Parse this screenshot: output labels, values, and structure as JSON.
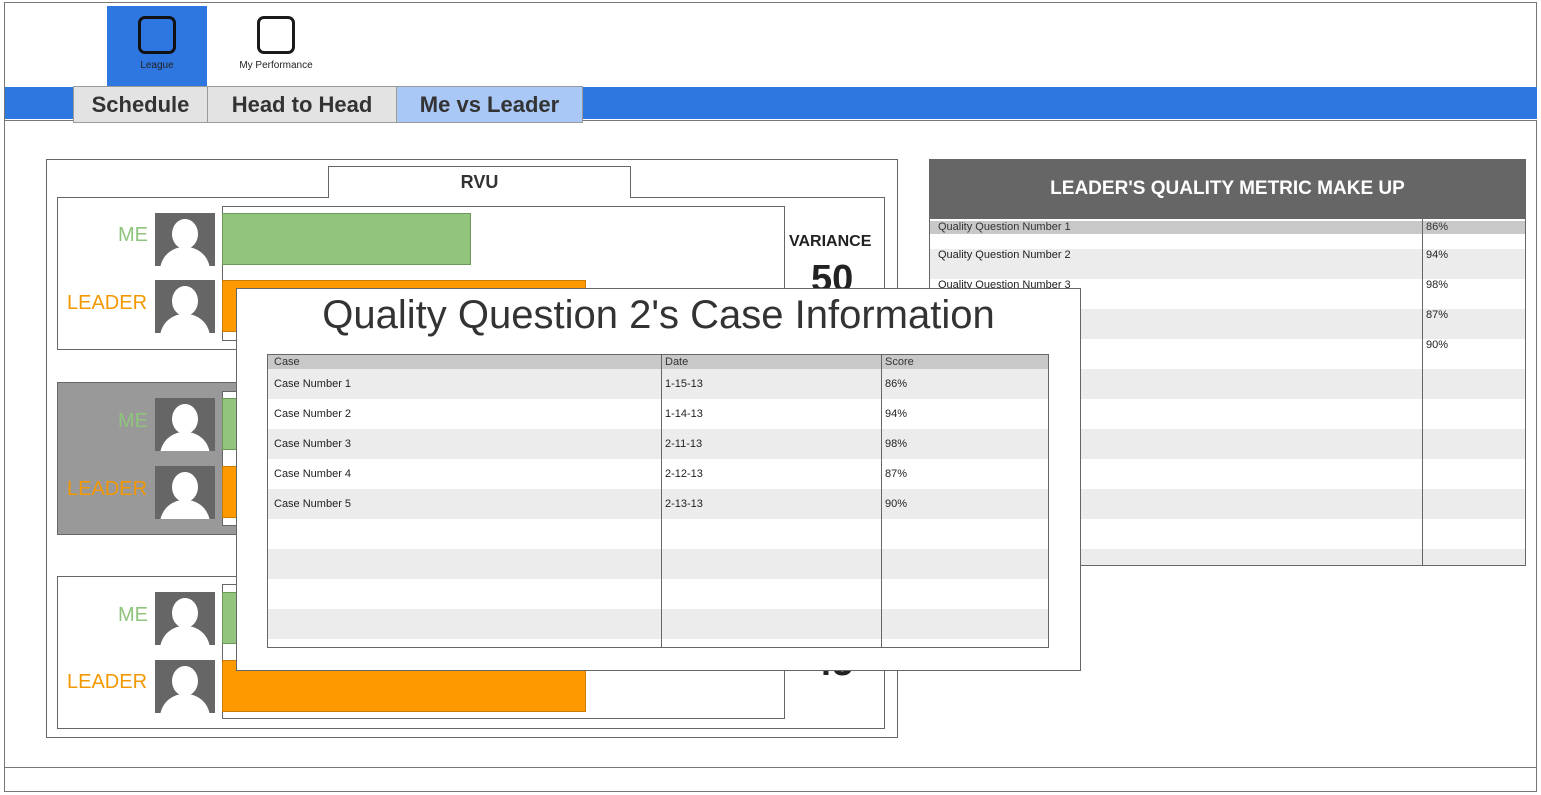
{
  "apps": [
    {
      "label": "League",
      "active": true
    },
    {
      "label": "My Performance",
      "active": false
    }
  ],
  "tabs": [
    {
      "label": "Schedule"
    },
    {
      "label": "Head to Head"
    },
    {
      "label": "Me vs Leader",
      "active": true
    }
  ],
  "comparison": {
    "title": "RVU",
    "me_label": "ME",
    "leader_label": "LEADER",
    "variance_label": "VARIANCE",
    "metrics": [
      {
        "variance": "50"
      },
      {
        "variance": ""
      },
      {
        "variance": "45"
      }
    ]
  },
  "leader_panel": {
    "title": "LEADER'S QUALITY METRIC MAKE UP",
    "rows": [
      {
        "question": "Quality Question Number 1",
        "score": "86%"
      },
      {
        "question": "Quality Question Number 2",
        "score": "94%"
      },
      {
        "question": "Quality Question Number 3",
        "score": "98%"
      },
      {
        "question": "",
        "score": "87%"
      },
      {
        "question": "",
        "score": "90%"
      }
    ]
  },
  "modal": {
    "title": "Quality Question 2's Case Information",
    "columns": {
      "case": "Case",
      "date": "Date",
      "score": "Score"
    },
    "rows": [
      {
        "case": "Case Number 1",
        "date": "1-15-13",
        "score": "86%"
      },
      {
        "case": "Case  Number 2",
        "date": "1-14-13",
        "score": "94%"
      },
      {
        "case": "Case  Number 3",
        "date": "2-11-13",
        "score": "98%"
      },
      {
        "case": "Case  Number 4",
        "date": "2-12-13",
        "score": "87%"
      },
      {
        "case": "Case  Number 5",
        "date": "2-13-13",
        "score": "90%"
      }
    ]
  },
  "colors": {
    "accent_blue": "#2f77e0",
    "me_green": "#93c47d",
    "leader_orange": "#ff9900",
    "header_gray": "#666666"
  }
}
